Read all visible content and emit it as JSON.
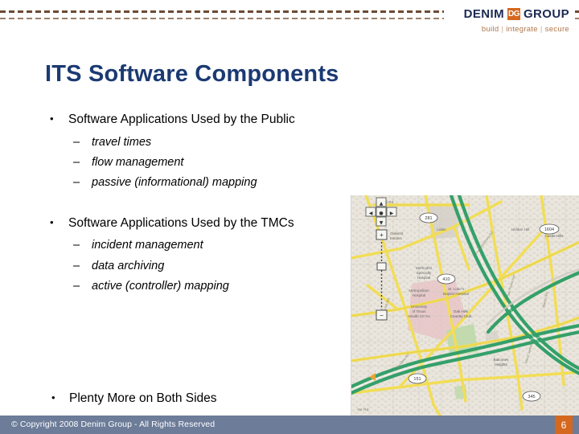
{
  "brand": {
    "name_part1": "DENIM",
    "monogram": "DG",
    "name_part2": "GROUP",
    "tagline_build": "build",
    "tagline_integrate": "integrate",
    "tagline_secure": "secure",
    "separator": "|",
    "navy": "#1b2a52",
    "orange": "#d4681e",
    "tagline_color": "#b0764b"
  },
  "slide": {
    "title": "ITS Software Components",
    "title_color": "#1b3a73",
    "bullet_marker": "•",
    "sub_marker": "–",
    "groups": [
      {
        "heading": "Software Applications Used by the Public",
        "items": [
          "travel times",
          "flow management",
          "passive (informational) mapping"
        ]
      },
      {
        "heading": "Software Applications Used by the TMCs",
        "items": [
          "incident management",
          "data archiving",
          "active (controller) mapping"
        ]
      }
    ],
    "closing_bullet": "Plenty More on Both Sides"
  },
  "map": {
    "alt": "Traffic map showing highways, arterials and neighborhoods",
    "controls": {
      "pan_up": "▲",
      "pan_left": "◄",
      "pan_center": "●",
      "pan_right": "►",
      "pan_down": "▼",
      "zoom_in": "+",
      "zoom_out": "−",
      "overview_label": "Oakland Estates"
    },
    "labels": [
      "Fred Rd",
      "Lidan",
      "Hidden Hill",
      "Castle Hills",
      "Methodist Specialty Hospital",
      "Metropolitan Hospital",
      "St. Luke's Baptist Hospital",
      "University of Texas Health Science",
      "Oak Hills Country Club",
      "Balcones Heights",
      "Blanco Rd",
      "Fredericksburg Rd",
      "San Pedro Ave",
      "Vance Jackson Rd",
      "Babcock Rd"
    ],
    "shields": [
      "281",
      "1604",
      "410",
      "151",
      "345"
    ],
    "colors": {
      "freeway": "#34a06a",
      "arterial": "#f2dd55",
      "land": "#eae6dd",
      "hospital": "#e8c4c8",
      "park": "#bcd9a8",
      "building": "#d4d0c7"
    }
  },
  "footer": {
    "copyright": "© Copyright 2008 Denim Group - All Rights Reserved",
    "page_number": "6",
    "bar_color": "#6c7c99",
    "badge_color": "#d4681e"
  }
}
